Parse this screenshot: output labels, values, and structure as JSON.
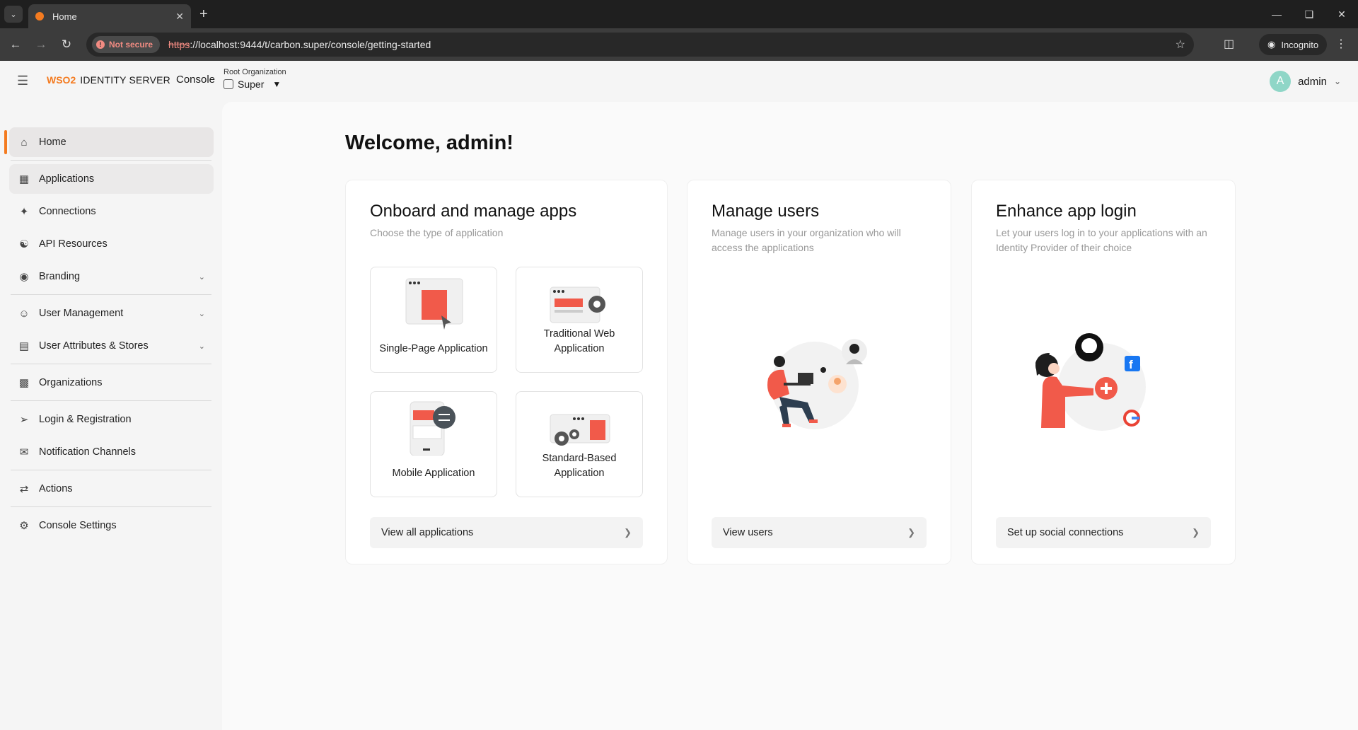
{
  "browser": {
    "tab_title": "Home",
    "security_label": "Not secure",
    "url_scheme": "https",
    "url_rest": "://localhost:9444/t/carbon.super/console/getting-started",
    "incognito_label": "Incognito"
  },
  "header": {
    "logo_brand": "WSO2",
    "product": "IDENTITY SERVER",
    "console": "Console",
    "org_caption": "Root Organization",
    "org_name": "Super",
    "user_name": "admin",
    "avatar_letter": "A"
  },
  "sidebar": {
    "items": [
      {
        "label": "Home",
        "icon": "home-icon"
      },
      {
        "label": "Applications",
        "icon": "applications-icon"
      },
      {
        "label": "Connections",
        "icon": "connections-icon"
      },
      {
        "label": "API Resources",
        "icon": "api-resources-icon"
      },
      {
        "label": "Branding",
        "icon": "branding-icon"
      },
      {
        "label": "User Management",
        "icon": "user-management-icon"
      },
      {
        "label": "User Attributes & Stores",
        "icon": "user-attributes-icon"
      },
      {
        "label": "Organizations",
        "icon": "organizations-icon"
      },
      {
        "label": "Login & Registration",
        "icon": "login-registration-icon"
      },
      {
        "label": "Notification Channels",
        "icon": "notification-channels-icon"
      },
      {
        "label": "Actions",
        "icon": "actions-icon"
      },
      {
        "label": "Console Settings",
        "icon": "console-settings-icon"
      }
    ]
  },
  "main": {
    "welcome": "Welcome, admin!",
    "cards": {
      "apps": {
        "title": "Onboard and manage apps",
        "subtitle": "Choose the type of application",
        "tiles": [
          "Single-Page Application",
          "Traditional Web Application",
          "Mobile Application",
          "Standard-Based Application"
        ],
        "action": "View all applications"
      },
      "users": {
        "title": "Manage users",
        "subtitle": "Manage users in your organization who will access the applications",
        "action": "View users"
      },
      "login": {
        "title": "Enhance app login",
        "subtitle": "Let your users log in to your applications with an Identity Provider of their choice",
        "action": "Set up social connections"
      }
    }
  },
  "colors": {
    "accent": "#f47b20",
    "illustration_red": "#f15a4a",
    "avatar": "#8fd6c7"
  }
}
